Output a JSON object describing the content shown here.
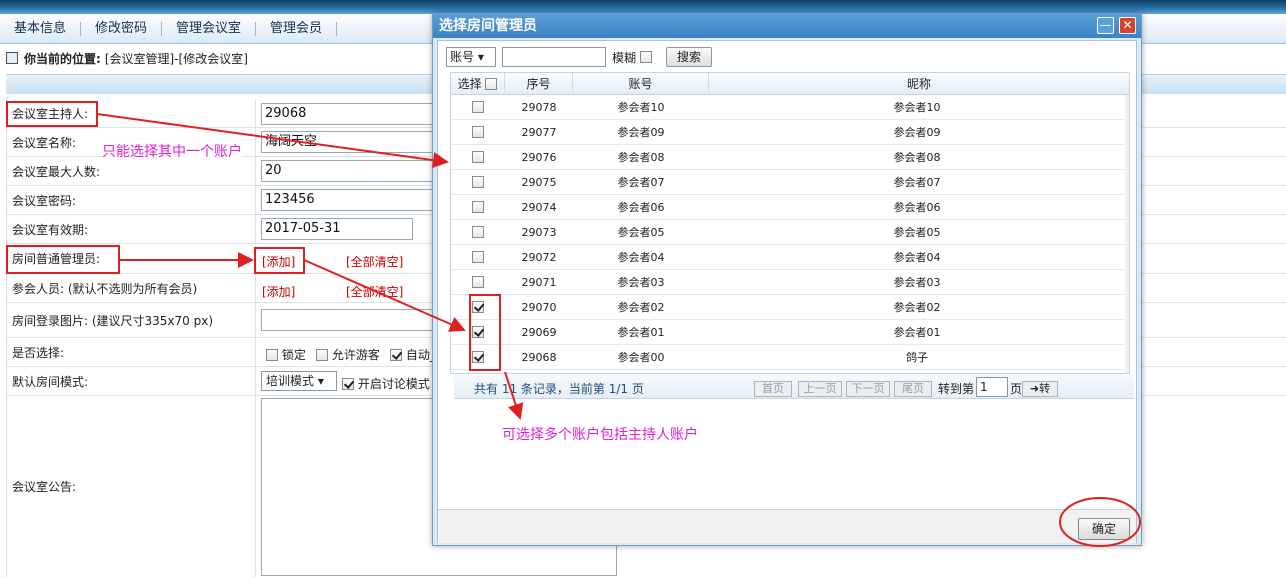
{
  "menu": [
    "基本信息",
    "修改密码",
    "管理会议室",
    "管理会员"
  ],
  "breadcrumb": {
    "label": "你当前的位置:",
    "path": "[会议室管理]-[修改会议室]"
  },
  "form": {
    "host_label": "会议室主持人:",
    "host_value": "29068",
    "name_label": "会议室名称:",
    "name_value": "海阔天空",
    "max_label": "会议室最大人数:",
    "max_value": "20",
    "pwd_label": "会议室密码:",
    "pwd_value": "123456",
    "exp_label": "会议室有效期:",
    "exp_value": "2017-05-31",
    "admin_label": "房间普通管理员:",
    "add": "[添加]",
    "clear": "[全部清空]",
    "member_label": "参会人员: (默认不选则为所有会员)",
    "img_label": "房间登录图片: (建议尺寸335x70 px)",
    "opt_label": "是否选择:",
    "lock": "锁定",
    "guest": "允许游客",
    "auto": "自动_",
    "mode_label": "默认房间模式:",
    "mode_value": "培训模式",
    "discuss": "开启讨论模式",
    "notice_label": "会议室公告:"
  },
  "dialog": {
    "title": "选择房间管理员",
    "search_field": "账号",
    "fuzzy": "模糊",
    "search_btn": "搜索",
    "cols": [
      "选择",
      "序号",
      "账号",
      "昵称"
    ],
    "rows": [
      {
        "id": "29078",
        "acc": "参会者10",
        "nick": "参会者10",
        "checked": false
      },
      {
        "id": "29077",
        "acc": "参会者09",
        "nick": "参会者09",
        "checked": false
      },
      {
        "id": "29076",
        "acc": "参会者08",
        "nick": "参会者08",
        "checked": false
      },
      {
        "id": "29075",
        "acc": "参会者07",
        "nick": "参会者07",
        "checked": false
      },
      {
        "id": "29074",
        "acc": "参会者06",
        "nick": "参会者06",
        "checked": false
      },
      {
        "id": "29073",
        "acc": "参会者05",
        "nick": "参会者05",
        "checked": false
      },
      {
        "id": "29072",
        "acc": "参会者04",
        "nick": "参会者04",
        "checked": false
      },
      {
        "id": "29071",
        "acc": "参会者03",
        "nick": "参会者03",
        "checked": false
      },
      {
        "id": "29070",
        "acc": "参会者02",
        "nick": "参会者02",
        "checked": true
      },
      {
        "id": "29069",
        "acc": "参会者01",
        "nick": "参会者01",
        "checked": true
      },
      {
        "id": "29068",
        "acc": "参会者00",
        "nick": "鸽子",
        "checked": true
      }
    ],
    "pager": {
      "summary": "共有 11 条记录，当前第 1/1 页",
      "first": "首页",
      "prev": "上一页",
      "next": "下一页",
      "last": "尾页",
      "goto": "转到第",
      "page": "1",
      "unit": "页",
      "go": "➜转"
    },
    "ok": "确定"
  },
  "annotations": {
    "single": "只能选择其中一个账户",
    "multi": "可选择多个账户包括主持人账户"
  },
  "colors": {
    "annot": "#e020d0",
    "red": "#e02020"
  }
}
